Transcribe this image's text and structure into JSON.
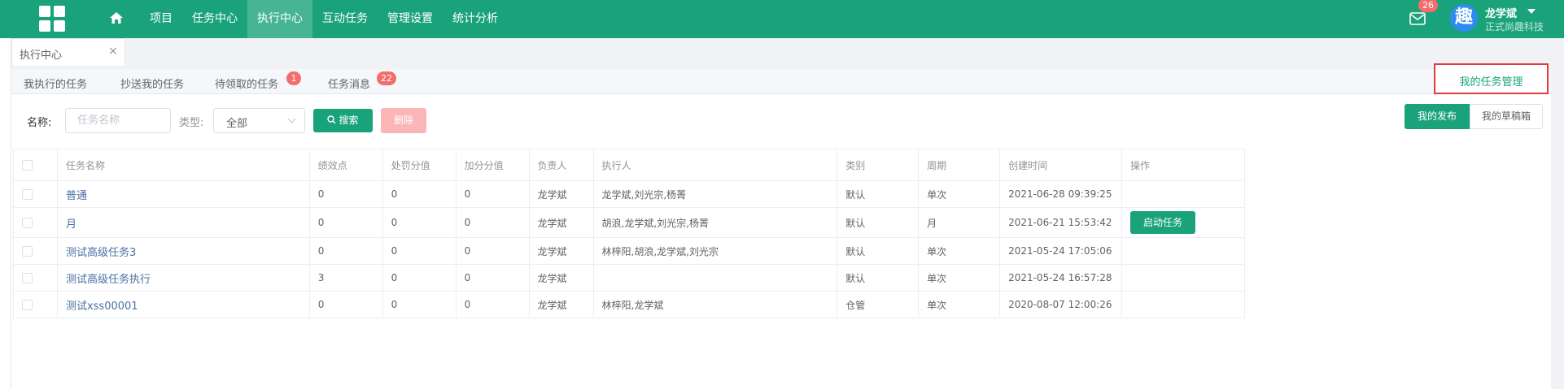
{
  "nav": {
    "items": [
      "项目",
      "任务中心",
      "执行中心",
      "互动任务",
      "管理设置",
      "统计分析"
    ],
    "active": "执行中心"
  },
  "user": {
    "mail_count": "26",
    "avatar_char": "趣",
    "name": "龙学斌",
    "org": "正式尚趣科技"
  },
  "page_tab": {
    "label": "执行中心",
    "close": "×"
  },
  "sub_tabs": {
    "items": [
      "我执行的任务",
      "抄送我的任务",
      "待领取的任务",
      "任务消息"
    ],
    "pending_badge": "1",
    "message_badge": "22",
    "manage": "我的任务管理"
  },
  "filters": {
    "name_label": "名称:",
    "name_placeholder": "任务名称",
    "type_label": "类型:",
    "type_value": "全部",
    "search_label": "搜索",
    "delete_label": "删除"
  },
  "view_toggle": {
    "published": "我的发布",
    "draft": "我的草稿箱"
  },
  "table": {
    "headers": [
      "任务名称",
      "绩效点",
      "处罚分值",
      "加分分值",
      "负责人",
      "执行人",
      "类别",
      "周期",
      "创建时间",
      "操作"
    ],
    "rows": [
      {
        "name": "普通",
        "points": "0",
        "penalty": "0",
        "bonus": "0",
        "owner": "龙学斌",
        "executors": "龙学斌,刘光宗,杨菁",
        "category": "默认",
        "cycle": "单次",
        "created": "2021-06-28 09:39:25",
        "action": ""
      },
      {
        "name": "月",
        "points": "0",
        "penalty": "0",
        "bonus": "0",
        "owner": "龙学斌",
        "executors": "胡浪,龙学斌,刘光宗,杨菁",
        "category": "默认",
        "cycle": "月",
        "created": "2021-06-21 15:53:42",
        "action": "启动任务"
      },
      {
        "name": "测试高级任务3",
        "points": "0",
        "penalty": "0",
        "bonus": "0",
        "owner": "龙学斌",
        "executors": "林梓阳,胡浪,龙学斌,刘光宗",
        "category": "默认",
        "cycle": "单次",
        "created": "2021-05-24 17:05:06",
        "action": ""
      },
      {
        "name": "测试高级任务执行",
        "points": "3",
        "penalty": "0",
        "bonus": "0",
        "owner": "龙学斌",
        "executors": "",
        "category": "默认",
        "cycle": "单次",
        "created": "2021-05-24 16:57:28",
        "action": ""
      },
      {
        "name": "测试xss00001",
        "points": "0",
        "penalty": "0",
        "bonus": "0",
        "owner": "龙学斌",
        "executors": "林梓阳,龙学斌",
        "category": "仓管",
        "cycle": "单次",
        "created": "2020-08-07 12:00:26",
        "action": ""
      }
    ]
  }
}
